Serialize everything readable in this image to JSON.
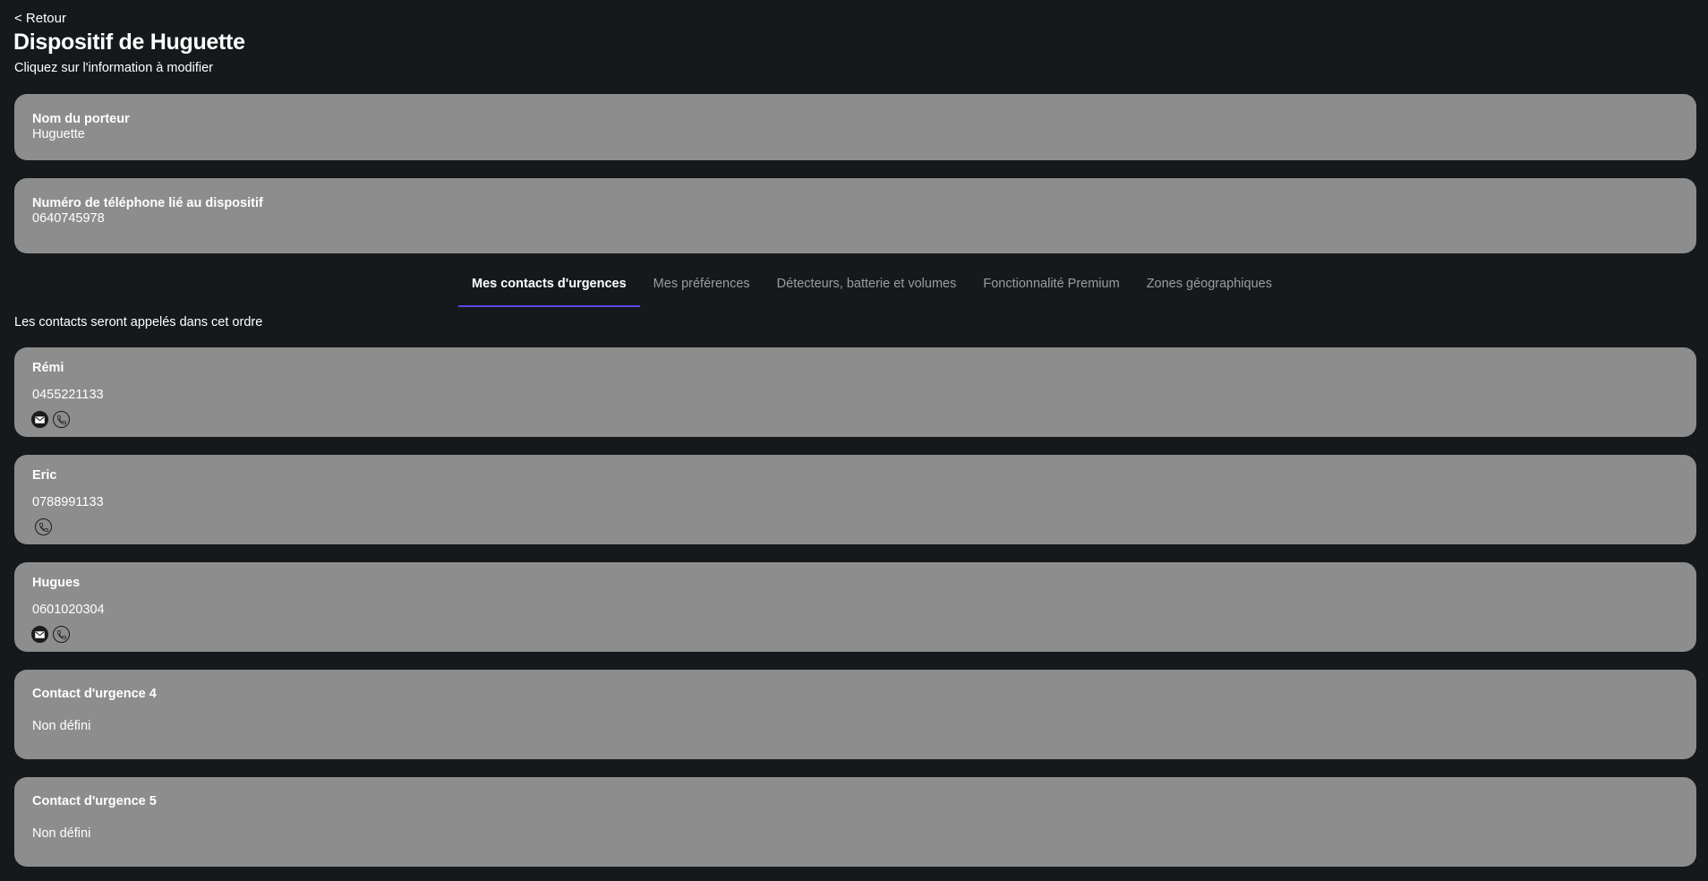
{
  "header": {
    "back_label": "< Retour",
    "title": "Dispositif de Huguette",
    "subtitle": "Cliquez sur l'information à modifier"
  },
  "device": {
    "wearer": {
      "label": "Nom du porteur",
      "value": "Huguette"
    },
    "phone": {
      "label": "Numéro de téléphone lié au dispositif",
      "value": "0640745978"
    }
  },
  "tabs": [
    {
      "label": "Mes contacts d'urgences",
      "active": true
    },
    {
      "label": "Mes préférences",
      "active": false
    },
    {
      "label": "Détecteurs, batterie et volumes",
      "active": false
    },
    {
      "label": "Fonctionnalité Premium",
      "active": false
    },
    {
      "label": "Zones géographiques",
      "active": false
    }
  ],
  "contacts_note": "Les contacts seront appelés dans cet ordre",
  "contacts": [
    {
      "name": "Rémi",
      "phone": "0455221133",
      "icons": [
        "email-icon",
        "phone-icon"
      ]
    },
    {
      "name": "Eric",
      "phone": "0788991133",
      "icons": [
        "phone-icon"
      ]
    },
    {
      "name": "Hugues",
      "phone": "0601020304",
      "icons": [
        "email-icon",
        "phone-icon"
      ]
    },
    {
      "name": "Contact d'urgence 4",
      "phone": "Non défini",
      "icons": []
    },
    {
      "name": "Contact d'urgence 5",
      "phone": "Non défini",
      "icons": []
    }
  ],
  "colors": {
    "background": "#15191c",
    "card": "#8d8d8d",
    "tab_underline": "#5b46e4",
    "inactive_tab": "#9c9c9c"
  }
}
